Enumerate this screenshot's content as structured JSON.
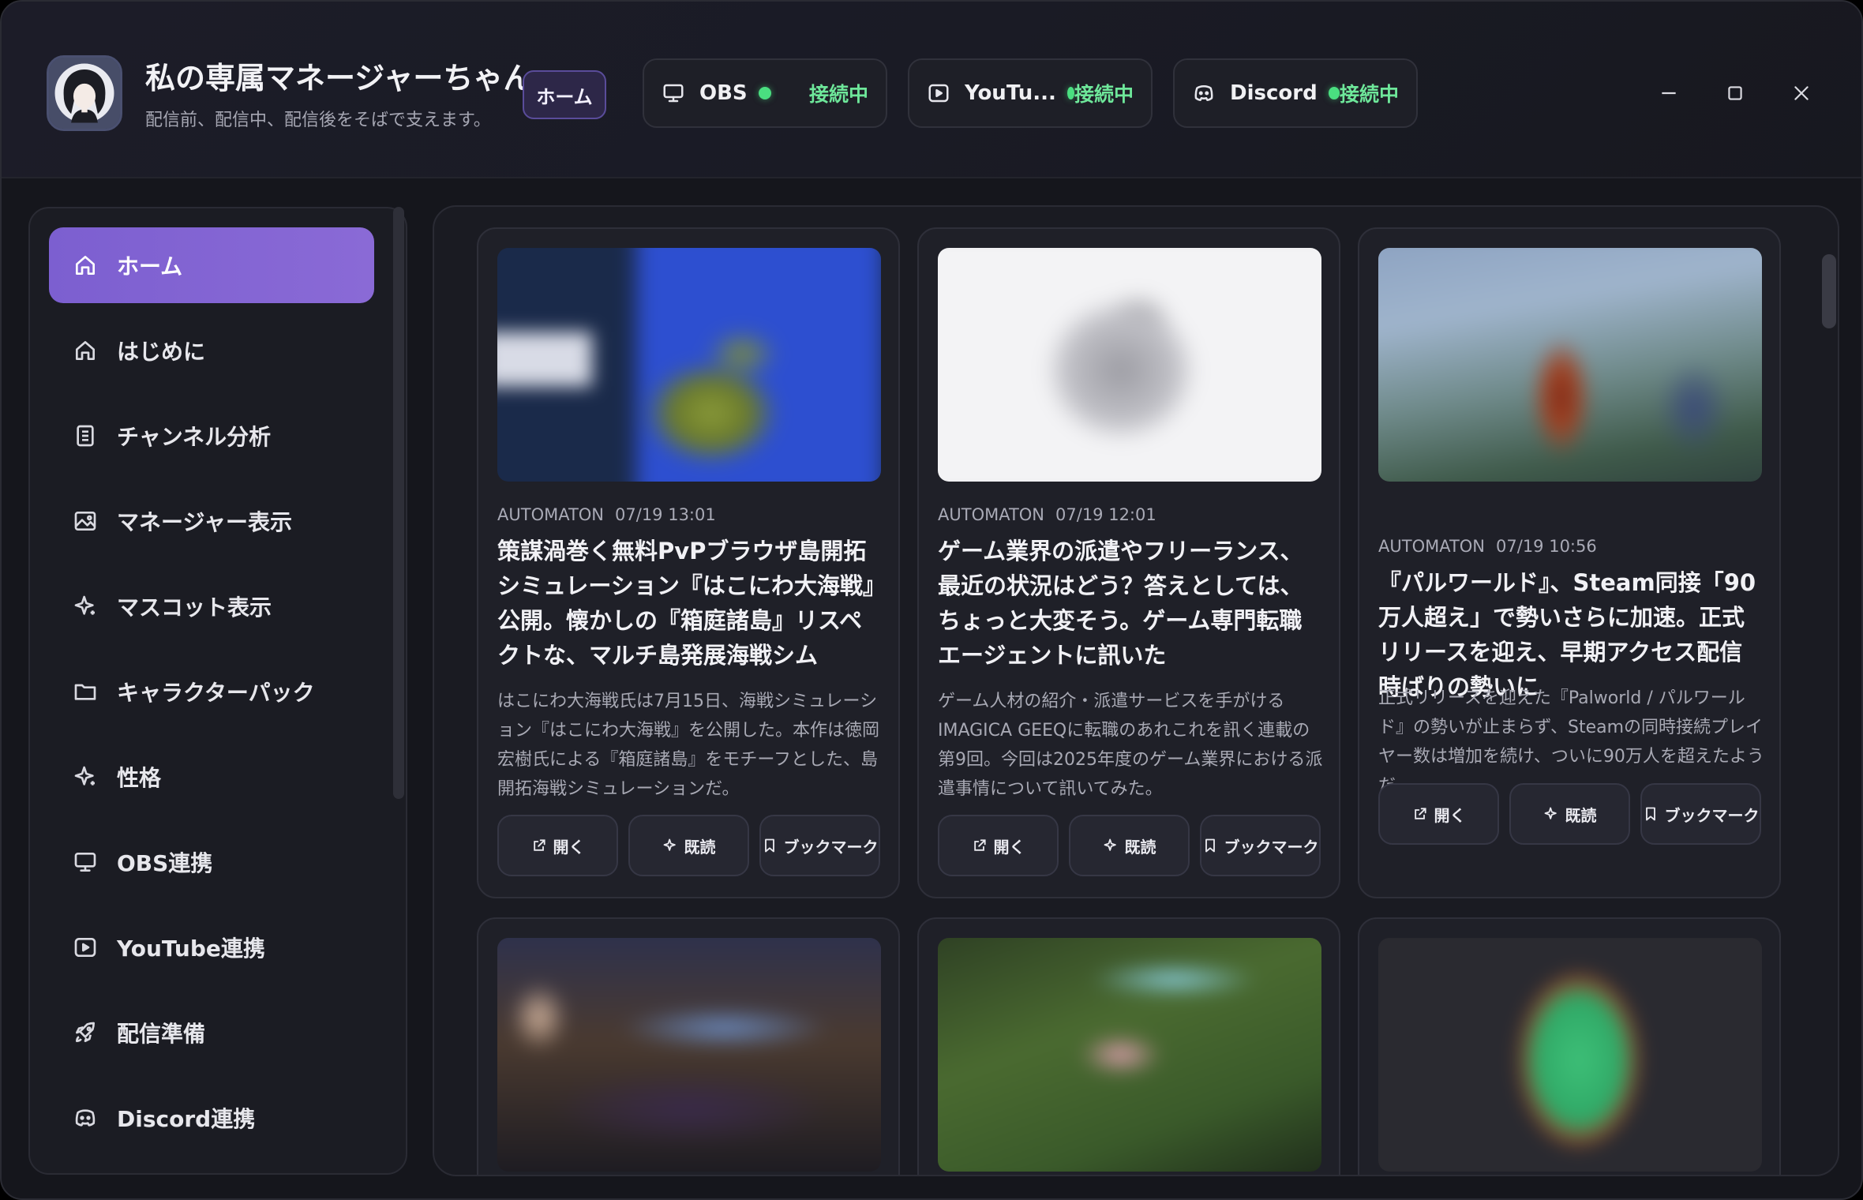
{
  "app": {
    "title": "私の専属マネージャーちゃん",
    "subtitle": "配信前、配信中、配信後をそばで支えます。",
    "home_pill": "ホーム"
  },
  "connections": [
    {
      "name": "OBS",
      "status": "接続中",
      "icon": "monitor-icon"
    },
    {
      "name": "YouTu...",
      "status": "接続中",
      "icon": "youtube-play-icon"
    },
    {
      "name": "Discord",
      "status": "接続中",
      "icon": "discord-icon"
    }
  ],
  "colors": {
    "accent": "#8a6ad6",
    "connected": "#4ade80"
  },
  "sidebar": {
    "items": [
      {
        "label": "ホーム",
        "icon": "home-icon"
      },
      {
        "label": "はじめに",
        "icon": "home-icon"
      },
      {
        "label": "チャンネル分析",
        "icon": "document-icon"
      },
      {
        "label": "マネージャー表示",
        "icon": "image-icon"
      },
      {
        "label": "マスコット表示",
        "icon": "sparkle-icon"
      },
      {
        "label": "キャラクターパック",
        "icon": "folder-icon"
      },
      {
        "label": "性格",
        "icon": "sparkle-icon"
      },
      {
        "label": "OBS連携",
        "icon": "monitor-icon"
      },
      {
        "label": "YouTube連携",
        "icon": "youtube-play-icon"
      },
      {
        "label": "配信準備",
        "icon": "rocket-icon"
      },
      {
        "label": "Discord連携",
        "icon": "discord-icon"
      }
    ]
  },
  "buttons": {
    "open": "開く",
    "read": "既読",
    "bookmark": "ブックマーク"
  },
  "articles": [
    {
      "source": "AUTOMATON",
      "time": "07/19 13:01",
      "title": "策謀渦巻く無料PvPブラウザ島開拓シミュレーション『はこにわ大海戦』公開。懐かしの『箱庭諸島』リスペクトな、マルチ島発展海戦シム",
      "desc": "はこにわ大海戦氏は7月15日、海戦シミュレーション『はこにわ大海戦』を公開した。本作は徳岡宏樹氏による『箱庭諸島』をモチーフとした、島開拓海戦シミュレーションだ。"
    },
    {
      "source": "AUTOMATON",
      "time": "07/19 12:01",
      "title": "ゲーム業界の派遣やフリーランス、最近の状況はどう？答えとしては、ちょっと大変そう。ゲーム専門転職エージェントに訊いた",
      "desc": "ゲーム人材の紹介・派遣サービスを手がけるIMAGICA GEEQに転職のあれこれを訊く連載の第9回。今回は2025年度のゲーム業界における派遣事情について訊いてみた。"
    },
    {
      "source": "AUTOMATON",
      "time": "07/19 10:56",
      "title": "『パルワールド』、Steam同接「90万人超え」で勢いさらに加速。正式リリースを迎え、早期アクセス配信時ばりの勢いに",
      "desc": "正式リリースを迎えた『Palworld / パルワールド』の勢いが止まらず、Steamの同時接続プレイヤー数は増加を続け、ついに90万人を超えたようだ。"
    }
  ]
}
